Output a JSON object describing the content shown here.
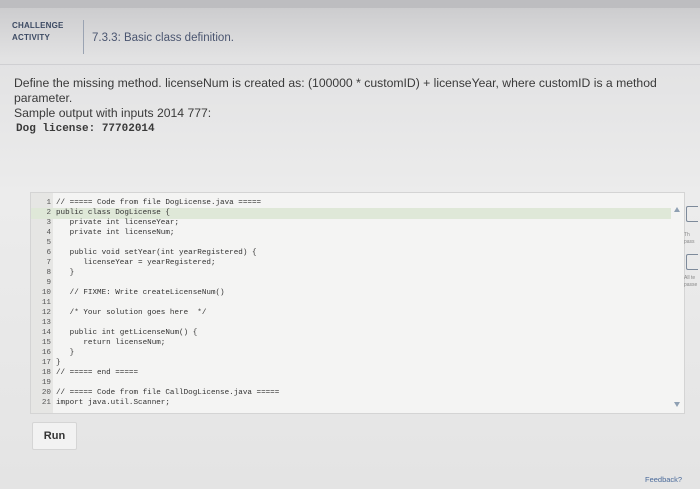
{
  "header": {
    "badge_line1": "CHALLENGE",
    "badge_line2": "ACTIVITY",
    "title": "7.3.3: Basic class definition."
  },
  "prompt": {
    "line1": "Define the missing method. licenseNum is created as: (100000 * customID) + licenseYear, where customID is a method parameter.",
    "line2": "Sample output with inputs 2014 777:"
  },
  "sample_output": "Dog license: 77702014",
  "code_lines": [
    {
      "n": "1",
      "text": "// ===== Code from file DogLicense.java ====="
    },
    {
      "n": "2",
      "text": "public class DogLicense {"
    },
    {
      "n": "3",
      "text": "   private int licenseYear;"
    },
    {
      "n": "4",
      "text": "   private int licenseNum;"
    },
    {
      "n": "5",
      "text": ""
    },
    {
      "n": "6",
      "text": "   public void setYear(int yearRegistered) {"
    },
    {
      "n": "7",
      "text": "      licenseYear = yearRegistered;"
    },
    {
      "n": "8",
      "text": "   }"
    },
    {
      "n": "9",
      "text": ""
    },
    {
      "n": "10",
      "text": "   // FIXME: Write createLicenseNum()"
    },
    {
      "n": "11",
      "text": ""
    },
    {
      "n": "12",
      "text": "   /* Your solution goes here  */"
    },
    {
      "n": "13",
      "text": ""
    },
    {
      "n": "14",
      "text": "   public int getLicenseNum() {"
    },
    {
      "n": "15",
      "text": "      return licenseNum;"
    },
    {
      "n": "16",
      "text": "   }"
    },
    {
      "n": "17",
      "text": "}"
    },
    {
      "n": "18",
      "text": "// ===== end ====="
    },
    {
      "n": "19",
      "text": ""
    },
    {
      "n": "20",
      "text": "// ===== Code from file CallDogLicense.java ====="
    },
    {
      "n": "21",
      "text": "import java.util.Scanner;"
    }
  ],
  "run_label": "Run",
  "feedback_label": "Feedback?",
  "side_notes": [
    "Th",
    "pass",
    "All te",
    "passe"
  ]
}
